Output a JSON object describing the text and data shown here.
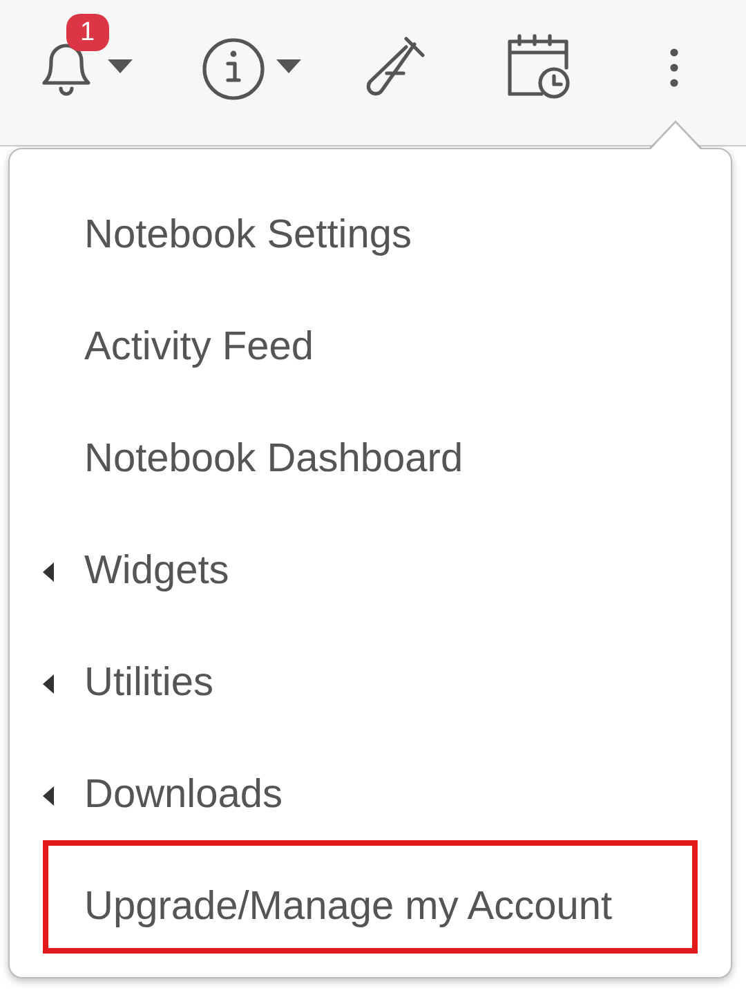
{
  "toolbar": {
    "notification_count": "1"
  },
  "menu": {
    "items": [
      {
        "label": "Notebook Settings",
        "kind": "link",
        "highlighted": false
      },
      {
        "label": "Activity Feed",
        "kind": "link",
        "highlighted": false
      },
      {
        "label": "Notebook Dashboard",
        "kind": "link",
        "highlighted": false
      },
      {
        "label": "Widgets",
        "kind": "submenu",
        "highlighted": false
      },
      {
        "label": "Utilities",
        "kind": "submenu",
        "highlighted": false
      },
      {
        "label": "Downloads",
        "kind": "submenu",
        "highlighted": false
      },
      {
        "label": "Upgrade/Manage my Account",
        "kind": "link",
        "highlighted": true
      }
    ]
  }
}
